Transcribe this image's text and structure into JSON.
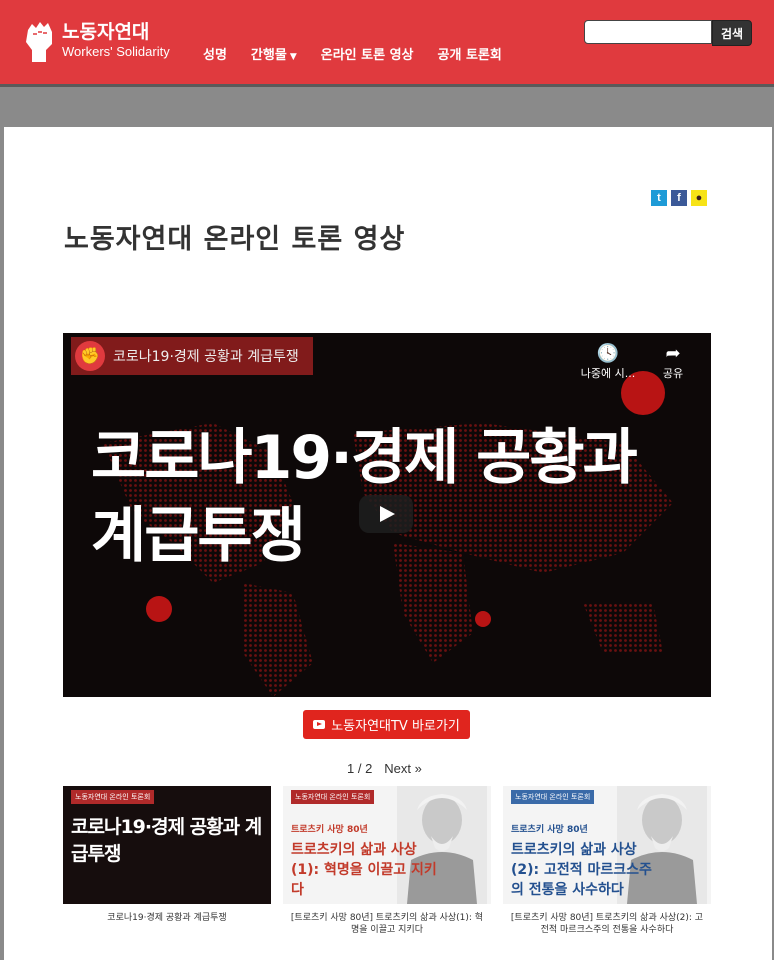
{
  "header": {
    "logo_ko": "노동자연대",
    "logo_en": "Workers' Solidarity",
    "nav": [
      {
        "label": "성명",
        "caret": ""
      },
      {
        "label": "간행물",
        "caret": "▼"
      },
      {
        "label": "온라인 토론 영상",
        "caret": ""
      },
      {
        "label": "공개 토론회",
        "caret": ""
      }
    ],
    "search": {
      "value": "",
      "button": "검색"
    }
  },
  "share": {
    "twitter": "t",
    "facebook": "f",
    "kakao": "●"
  },
  "page": {
    "title": "노동자연대 온라인 토론 영상"
  },
  "video": {
    "channel_avatar": "✊",
    "caption": "코로나19·경제 공황과 계급투쟁",
    "watch_later": "나중에 시...",
    "watch_later_icon": "clock-icon",
    "share": "공유",
    "share_icon": "share-arrow-icon",
    "headline": "코로나19·경제 공황과 계급투쟁"
  },
  "tv_button": {
    "label": "노동자연대TV 바로가기",
    "icon": "youtube-icon"
  },
  "pagination": {
    "current": "1 / 2",
    "next": "Next »"
  },
  "videos": [
    {
      "tag": "노동자연대 온라인 토론회",
      "headline": "코로나19·경제 공황과 계급투쟁",
      "caption": "코로나19·경제 공황과 계급투쟁"
    },
    {
      "tag": "노동자연대 온라인 토론회",
      "sub": "트로츠키 사망 80년",
      "title": "트로츠키의 삶과 사상(1): 혁명을 이끌고 지키다",
      "caption": "[트로츠키 사망 80년] 트로츠키의 삶과 사상(1): 혁명을 이끌고 지키다"
    },
    {
      "tag": "노동자연대 온라인 토론회",
      "sub": "트로츠키 사망 80년",
      "title": "트로츠키의 삶과 사상(2): 고전적 마르크스주의 전통을 사수하다",
      "caption": "[트로츠키 사망 80년] 트로츠키의 삶과 사상(2): 고전적 마르크스주의 전통을 사수하다"
    }
  ],
  "colors": {
    "brand_red": "#e03a3e",
    "button_red": "#e0251e",
    "title_text": "#333333"
  }
}
